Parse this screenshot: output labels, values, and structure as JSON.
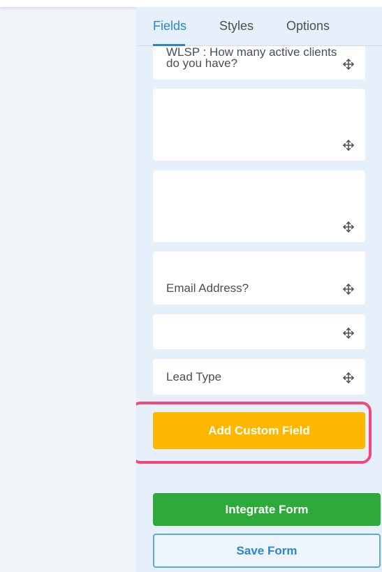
{
  "tabs": [
    {
      "label": "Fields",
      "active": true
    },
    {
      "label": "Styles",
      "active": false
    },
    {
      "label": "Options",
      "active": false
    }
  ],
  "fields": [
    {
      "label_line1": "WLSP : How many active clients",
      "label_line2": "do you have?"
    },
    {
      "label": ""
    },
    {
      "label": ""
    },
    {
      "label": "Email Address?"
    },
    {
      "label": ""
    },
    {
      "label": "Lead Type"
    }
  ],
  "buttons": {
    "add_custom_field": "Add Custom Field",
    "integrate_form": "Integrate Form",
    "save_form": "Save Form"
  },
  "icons": {
    "field_handle": "move-icon"
  },
  "colors": {
    "accent": "#2a87c9",
    "add_button": "#fcb800",
    "integrate_button": "#2eaa3a",
    "highlight": "#f4467a"
  }
}
